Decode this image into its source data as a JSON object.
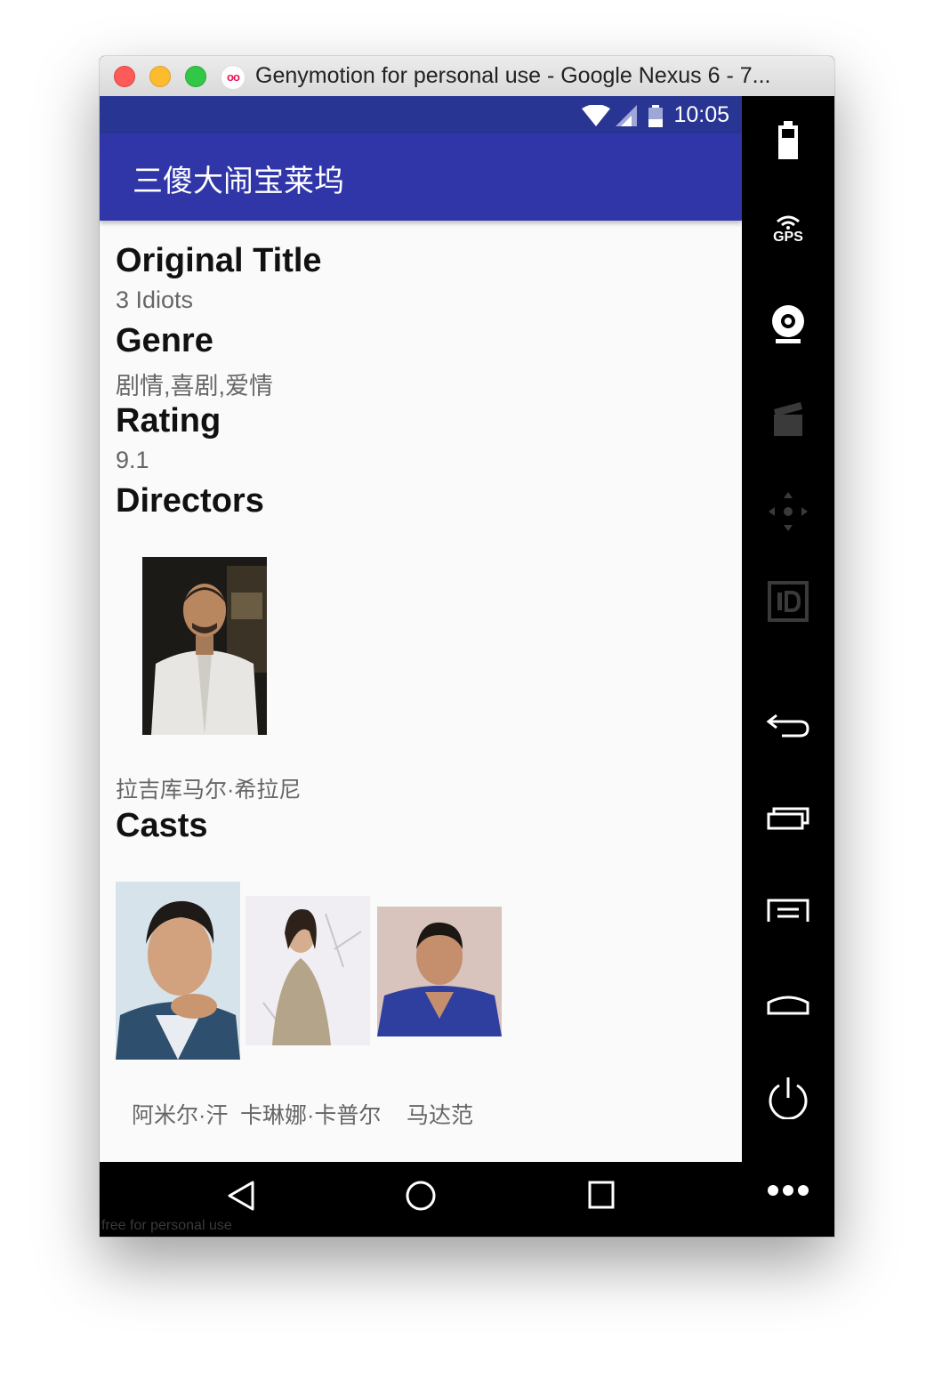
{
  "window": {
    "title": "Genymotion for personal use - Google Nexus 6 - 7..."
  },
  "status_bar": {
    "time": "10:05"
  },
  "app_bar": {
    "title": "三傻大闹宝莱坞"
  },
  "movie": {
    "original_title_label": "Original Title",
    "original_title": "3 Idiots",
    "genre_label": "Genre",
    "genre": "剧情,喜剧,爱情",
    "rating_label": "Rating",
    "rating": "9.1",
    "directors_label": "Directors",
    "directors": [
      {
        "name": "拉吉库马尔·希拉尼"
      }
    ],
    "casts_label": "Casts",
    "casts": [
      {
        "name": "阿米尔·汗"
      },
      {
        "name": "卡琳娜·卡普尔"
      },
      {
        "name": "马达范"
      }
    ]
  },
  "watermark": "free for personal use",
  "side_toolbar": {
    "gps_label": "GPS",
    "items": [
      "battery-icon",
      "gps-icon",
      "webcam-icon",
      "screencast-icon",
      "dpad-icon",
      "device-id-icon",
      "back-icon",
      "recent-apps-icon",
      "menu-icon",
      "home-icon",
      "power-icon",
      "more-icon"
    ]
  },
  "nav_bar": {
    "items": [
      "nav-back-icon",
      "nav-home-icon",
      "nav-recents-icon"
    ]
  },
  "colors": {
    "status_bar": "#283593",
    "app_bar": "#3036a8",
    "screen_background": "#fafafa"
  }
}
